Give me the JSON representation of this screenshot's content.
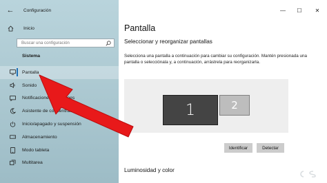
{
  "window": {
    "app_title": "Configuración",
    "back_icon": "back-arrow-icon",
    "controls": {
      "minimize": "—",
      "maximize": "☐",
      "close": "✕"
    }
  },
  "sidebar": {
    "home_label": "Inicio",
    "search_placeholder": "Buscar una configuración",
    "section_label": "Sistema",
    "items": [
      {
        "label": "Pantalla",
        "icon": "monitor-icon",
        "active": true
      },
      {
        "label": "Sonido",
        "icon": "speaker-icon"
      },
      {
        "label": "Notificaciones y acciones",
        "icon": "notification-icon"
      },
      {
        "label": "Asistente de concentración",
        "icon": "moon-icon"
      },
      {
        "label": "Inicio/apagado y suspensión",
        "icon": "power-icon"
      },
      {
        "label": "Almacenamiento",
        "icon": "storage-icon"
      },
      {
        "label": "Modo tableta",
        "icon": "tablet-icon"
      },
      {
        "label": "Multitarea",
        "icon": "multitask-icon"
      }
    ]
  },
  "main": {
    "title": "Pantalla",
    "section_heading": "Seleccionar y reorganizar pantallas",
    "description": "Selecciona una pantalla a continuación para cambiar su configuración. Mantén presionada una pantalla o selecciónala y, a continuación, arrástrela para reorganizarla.",
    "monitors": [
      {
        "number": "1",
        "selected": true
      },
      {
        "number": "2",
        "selected": false
      }
    ],
    "identify_button": "Identificar",
    "detect_button": "Detectar",
    "next_section": "Luminosidad y color"
  },
  "colors": {
    "sidebar_bg": "#aecad3",
    "accent": "#1b6fb8",
    "arrow": "#e8191a",
    "monitor_selected": "#444444",
    "monitor_other": "#bdbdbd"
  }
}
